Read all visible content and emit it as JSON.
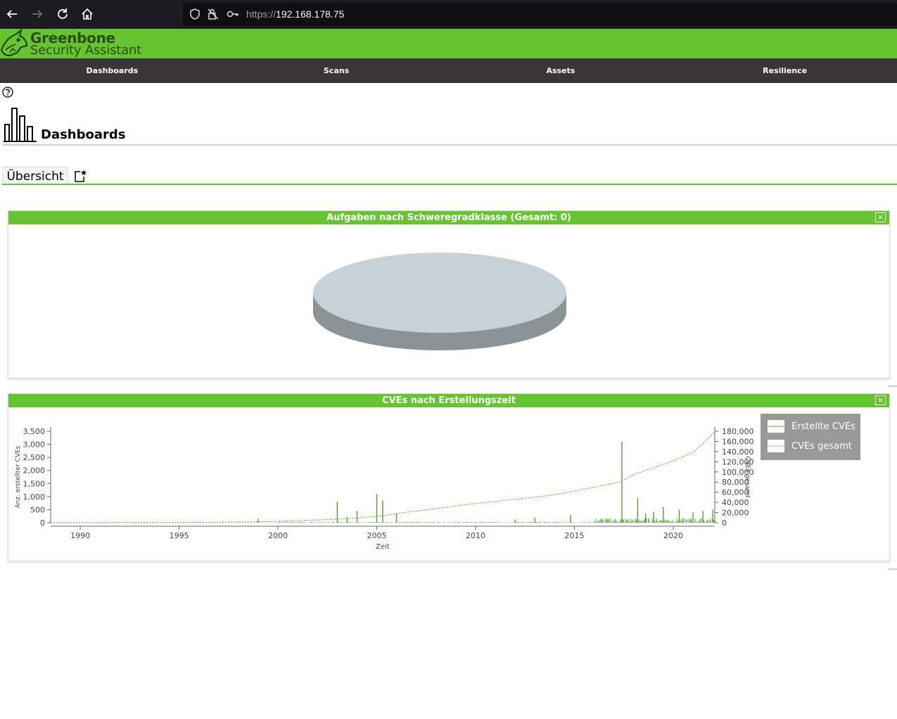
{
  "browser": {
    "url_scheme": "https://",
    "url_host": "192.168.178.75",
    "back_icon": "arrow-left-icon",
    "forward_icon": "arrow-right-icon",
    "reload_icon": "reload-icon",
    "home_icon": "home-icon"
  },
  "app": {
    "title_line1": "Greenbone",
    "title_line2": "Security Assistant",
    "brand_color": "#66c430",
    "menu_bg": "#393637"
  },
  "menu": {
    "items": [
      "Dashboards",
      "Scans",
      "Assets",
      "Resilience"
    ]
  },
  "page": {
    "title": "Dashboards",
    "tab_active": "Übersicht"
  },
  "panels": [
    {
      "title": "Aufgaben nach Schweregradklasse (Gesamt: 0)",
      "close_label": "×"
    },
    {
      "title": "CVEs nach Erstellungszeit",
      "close_label": "×"
    }
  ],
  "chart_data": [
    {
      "type": "pie",
      "title": "Aufgaben nach Schweregradklasse (Gesamt: 0)",
      "categories": [],
      "values": [],
      "total": 0,
      "empty_color": "#c7d1d8"
    },
    {
      "type": "line",
      "title": "CVEs nach Erstellungszeit",
      "xlabel": "Zeit",
      "ylabel": "Anz. erstellter CVEs",
      "y2label": "CVEs gesamt",
      "xlim": [
        1988.5,
        2022.1
      ],
      "ylim": [
        0,
        3500
      ],
      "y2lim": [
        0,
        180000
      ],
      "x_ticks": [
        "1990",
        "1995",
        "2000",
        "2005",
        "2010",
        "2015",
        "2020"
      ],
      "y_ticks": [
        "0",
        "500",
        "1,000",
        "1,500",
        "2,000",
        "2,500",
        "3,000",
        "3,500"
      ],
      "y2_ticks": [
        "0",
        "20,000",
        "40,000",
        "60,000",
        "80,000",
        "100,000",
        "120,000",
        "140,000",
        "160,000",
        "180,000"
      ],
      "legend": [
        "Erstellte CVEs",
        "CVEs gesamt"
      ],
      "legend_position": "top-right",
      "series": [
        {
          "name": "Erstellte CVEs",
          "style": "solid",
          "color": "#5a9a35",
          "x": [
            1999.0,
            2003.0,
            2003.5,
            2004.0,
            2005.0,
            2005.3,
            2006.0,
            2012.0,
            2013.0,
            2014.8,
            2017.4,
            2018.2,
            2018.6,
            2019.0,
            2019.5,
            2020.3,
            2021.0,
            2021.5,
            2022.0
          ],
          "values": [
            150,
            800,
            220,
            450,
            1100,
            850,
            350,
            120,
            200,
            300,
            3100,
            950,
            350,
            420,
            600,
            500,
            400,
            450,
            500
          ]
        },
        {
          "name": "CVEs gesamt",
          "style": "dashed",
          "color": "#5a9a35",
          "x": [
            1988.5,
            1995,
            1999,
            2001,
            2003,
            2005,
            2006,
            2008,
            2010,
            2012,
            2014,
            2015,
            2017.3,
            2018,
            2019,
            2020,
            2021,
            2022.1
          ],
          "values": [
            0,
            500,
            1500,
            4000,
            7000,
            12000,
            18000,
            28000,
            38000,
            46000,
            55000,
            62000,
            80000,
            95000,
            108000,
            122000,
            138000,
            178000
          ]
        }
      ]
    }
  ]
}
